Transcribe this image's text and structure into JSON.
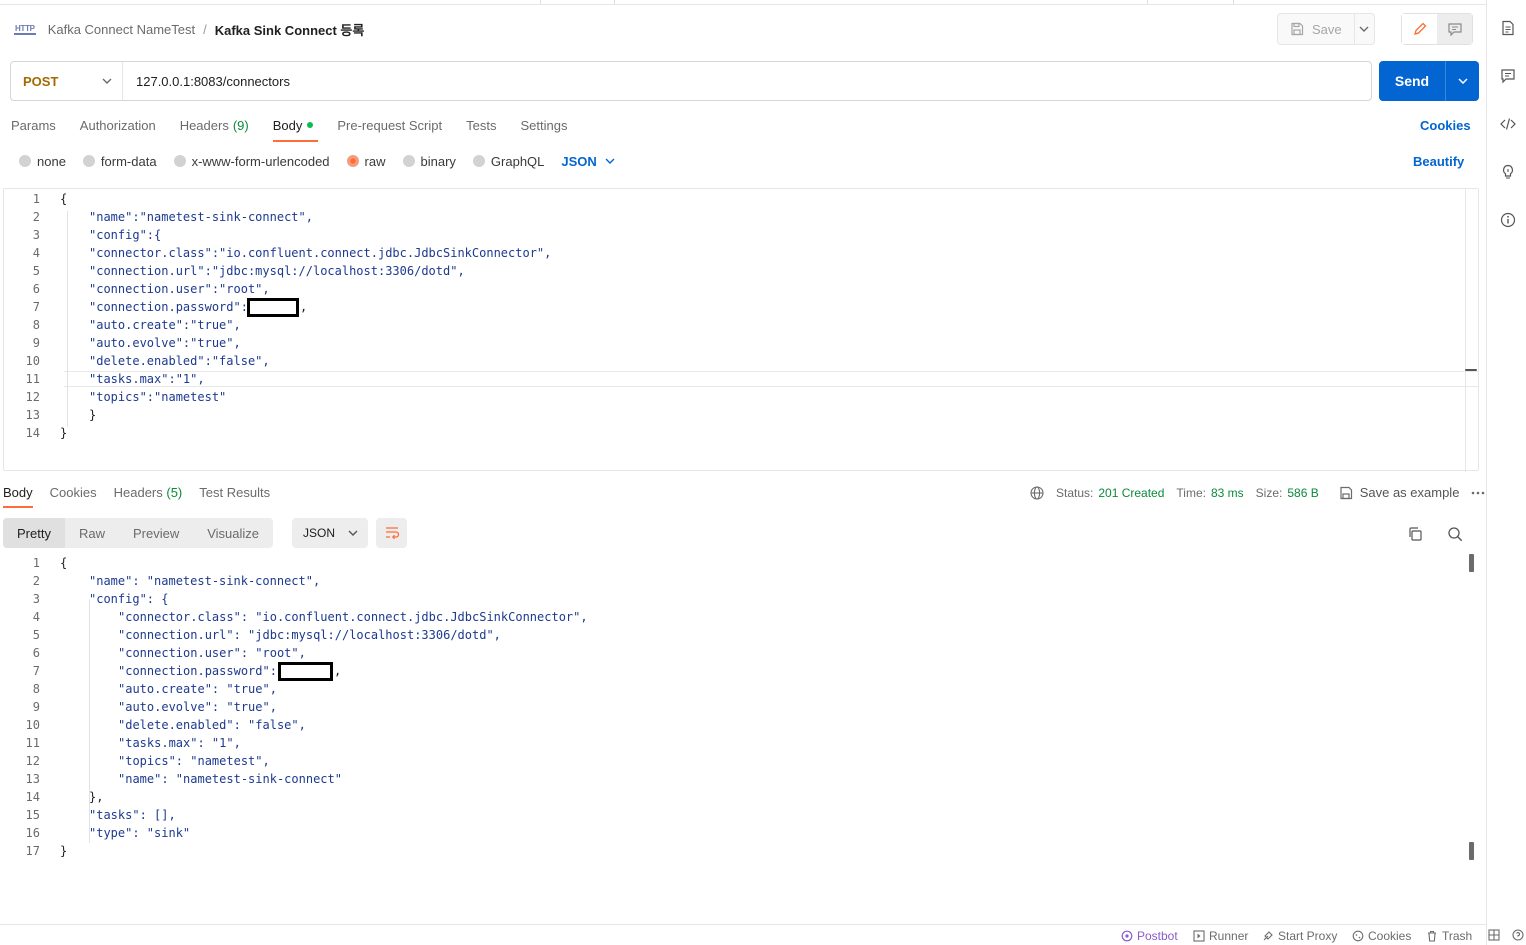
{
  "breadcrumb": {
    "icon": "HTTP",
    "parent": "Kafka Connect NameTest",
    "separator": "/",
    "current": "Kafka Sink Connect 등록"
  },
  "toolbar": {
    "save_label": "Save"
  },
  "request": {
    "method": "POST",
    "url": "127.0.0.1:8083/connectors",
    "send_label": "Send",
    "tabs": [
      {
        "label": "Params"
      },
      {
        "label": "Authorization"
      },
      {
        "label": "Headers",
        "count": "(9)"
      },
      {
        "label": "Body",
        "active": true
      },
      {
        "label": "Pre-request Script"
      },
      {
        "label": "Tests"
      },
      {
        "label": "Settings"
      }
    ],
    "cookies_label": "Cookies",
    "body_types": [
      "none",
      "form-data",
      "x-www-form-urlencoded",
      "raw",
      "binary",
      "GraphQL"
    ],
    "selected_body_type": "raw",
    "format": "JSON",
    "beautify_label": "Beautify",
    "line_numbers": [
      "1",
      "2",
      "3",
      "4",
      "5",
      "6",
      "7",
      "8",
      "9",
      "10",
      "11",
      "12",
      "13",
      "14"
    ],
    "lines": [
      "{",
      "\"name\":\"nametest-sink-connect\",",
      "\"config\":{",
      "\"connector.class\":\"io.confluent.connect.jdbc.JdbcSinkConnector\",",
      "\"connection.url\":\"jdbc:mysql://localhost:3306/dotd\",",
      "\"connection.user\":\"root\",",
      "\"connection.password\":",
      "\"auto.create\":\"true\",",
      "\"auto.evolve\":\"true\",",
      "\"delete.enabled\":\"false\",",
      "\"tasks.max\":\"1\",",
      "\"topics\":\"nametest\"",
      "}",
      "}"
    ]
  },
  "response": {
    "tabs": [
      {
        "label": "Body",
        "active": true
      },
      {
        "label": "Cookies"
      },
      {
        "label": "Headers",
        "count": "(5)"
      },
      {
        "label": "Test Results"
      }
    ],
    "status_label": "Status:",
    "status_value": "201 Created",
    "time_label": "Time:",
    "time_value": "83 ms",
    "size_label": "Size:",
    "size_value": "586 B",
    "save_example_label": "Save as example",
    "views": [
      "Pretty",
      "Raw",
      "Preview",
      "Visualize"
    ],
    "format": "JSON",
    "line_numbers": [
      "1",
      "2",
      "3",
      "4",
      "5",
      "6",
      "7",
      "8",
      "9",
      "10",
      "11",
      "12",
      "13",
      "14",
      "15",
      "16",
      "17"
    ],
    "lines": [
      "{",
      "\"name\": \"nametest-sink-connect\",",
      "\"config\": {",
      "\"connector.class\": \"io.confluent.connect.jdbc.JdbcSinkConnector\",",
      "\"connection.url\": \"jdbc:mysql://localhost:3306/dotd\",",
      "\"connection.user\": \"root\",",
      "\"connection.password\":",
      "\"auto.create\": \"true\",",
      "\"auto.evolve\": \"true\",",
      "\"delete.enabled\": \"false\",",
      "\"tasks.max\": \"1\",",
      "\"topics\": \"nametest\",",
      "\"name\": \"nametest-sink-connect\"",
      "},",
      "\"tasks\": [],",
      "\"type\": \"sink\"",
      "}"
    ]
  },
  "footer": {
    "items": [
      "Postbot",
      "Runner",
      "Start Proxy",
      "Cookies",
      "Trash"
    ]
  },
  "colors": {
    "accent": "#ff6c37",
    "send": "#0265d2",
    "status_ok": "#0a8a3a",
    "method_post": "#a36a00"
  }
}
